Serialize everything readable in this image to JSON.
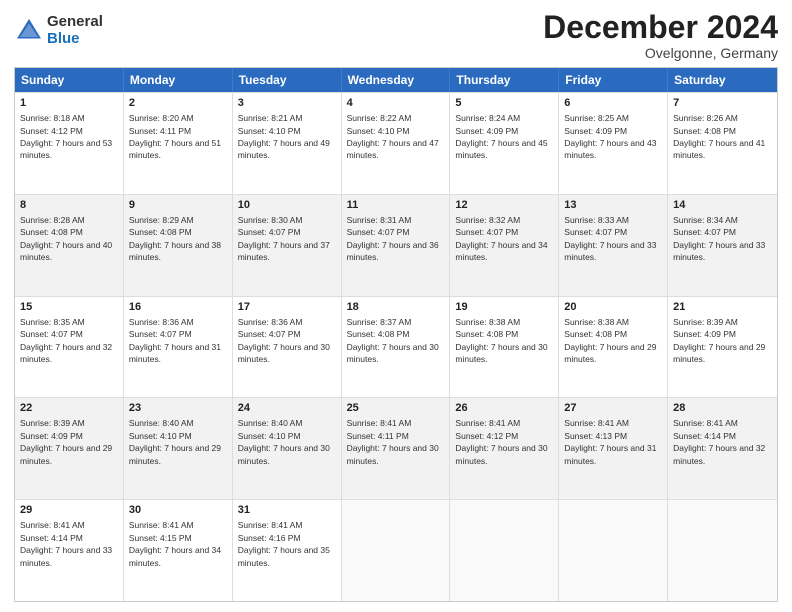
{
  "logo": {
    "general": "General",
    "blue": "Blue"
  },
  "header": {
    "title": "December 2024",
    "subtitle": "Ovelgonne, Germany"
  },
  "days": [
    "Sunday",
    "Monday",
    "Tuesday",
    "Wednesday",
    "Thursday",
    "Friday",
    "Saturday"
  ],
  "weeks": [
    [
      {
        "day": "1",
        "sunrise": "8:18 AM",
        "sunset": "4:12 PM",
        "daylight": "7 hours and 53 minutes."
      },
      {
        "day": "2",
        "sunrise": "8:20 AM",
        "sunset": "4:11 PM",
        "daylight": "7 hours and 51 minutes."
      },
      {
        "day": "3",
        "sunrise": "8:21 AM",
        "sunset": "4:10 PM",
        "daylight": "7 hours and 49 minutes."
      },
      {
        "day": "4",
        "sunrise": "8:22 AM",
        "sunset": "4:10 PM",
        "daylight": "7 hours and 47 minutes."
      },
      {
        "day": "5",
        "sunrise": "8:24 AM",
        "sunset": "4:09 PM",
        "daylight": "7 hours and 45 minutes."
      },
      {
        "day": "6",
        "sunrise": "8:25 AM",
        "sunset": "4:09 PM",
        "daylight": "7 hours and 43 minutes."
      },
      {
        "day": "7",
        "sunrise": "8:26 AM",
        "sunset": "4:08 PM",
        "daylight": "7 hours and 41 minutes."
      }
    ],
    [
      {
        "day": "8",
        "sunrise": "8:28 AM",
        "sunset": "4:08 PM",
        "daylight": "7 hours and 40 minutes."
      },
      {
        "day": "9",
        "sunrise": "8:29 AM",
        "sunset": "4:08 PM",
        "daylight": "7 hours and 38 minutes."
      },
      {
        "day": "10",
        "sunrise": "8:30 AM",
        "sunset": "4:07 PM",
        "daylight": "7 hours and 37 minutes."
      },
      {
        "day": "11",
        "sunrise": "8:31 AM",
        "sunset": "4:07 PM",
        "daylight": "7 hours and 36 minutes."
      },
      {
        "day": "12",
        "sunrise": "8:32 AM",
        "sunset": "4:07 PM",
        "daylight": "7 hours and 34 minutes."
      },
      {
        "day": "13",
        "sunrise": "8:33 AM",
        "sunset": "4:07 PM",
        "daylight": "7 hours and 33 minutes."
      },
      {
        "day": "14",
        "sunrise": "8:34 AM",
        "sunset": "4:07 PM",
        "daylight": "7 hours and 33 minutes."
      }
    ],
    [
      {
        "day": "15",
        "sunrise": "8:35 AM",
        "sunset": "4:07 PM",
        "daylight": "7 hours and 32 minutes."
      },
      {
        "day": "16",
        "sunrise": "8:36 AM",
        "sunset": "4:07 PM",
        "daylight": "7 hours and 31 minutes."
      },
      {
        "day": "17",
        "sunrise": "8:36 AM",
        "sunset": "4:07 PM",
        "daylight": "7 hours and 30 minutes."
      },
      {
        "day": "18",
        "sunrise": "8:37 AM",
        "sunset": "4:08 PM",
        "daylight": "7 hours and 30 minutes."
      },
      {
        "day": "19",
        "sunrise": "8:38 AM",
        "sunset": "4:08 PM",
        "daylight": "7 hours and 30 minutes."
      },
      {
        "day": "20",
        "sunrise": "8:38 AM",
        "sunset": "4:08 PM",
        "daylight": "7 hours and 29 minutes."
      },
      {
        "day": "21",
        "sunrise": "8:39 AM",
        "sunset": "4:09 PM",
        "daylight": "7 hours and 29 minutes."
      }
    ],
    [
      {
        "day": "22",
        "sunrise": "8:39 AM",
        "sunset": "4:09 PM",
        "daylight": "7 hours and 29 minutes."
      },
      {
        "day": "23",
        "sunrise": "8:40 AM",
        "sunset": "4:10 PM",
        "daylight": "7 hours and 29 minutes."
      },
      {
        "day": "24",
        "sunrise": "8:40 AM",
        "sunset": "4:10 PM",
        "daylight": "7 hours and 30 minutes."
      },
      {
        "day": "25",
        "sunrise": "8:41 AM",
        "sunset": "4:11 PM",
        "daylight": "7 hours and 30 minutes."
      },
      {
        "day": "26",
        "sunrise": "8:41 AM",
        "sunset": "4:12 PM",
        "daylight": "7 hours and 30 minutes."
      },
      {
        "day": "27",
        "sunrise": "8:41 AM",
        "sunset": "4:13 PM",
        "daylight": "7 hours and 31 minutes."
      },
      {
        "day": "28",
        "sunrise": "8:41 AM",
        "sunset": "4:14 PM",
        "daylight": "7 hours and 32 minutes."
      }
    ],
    [
      {
        "day": "29",
        "sunrise": "8:41 AM",
        "sunset": "4:14 PM",
        "daylight": "7 hours and 33 minutes."
      },
      {
        "day": "30",
        "sunrise": "8:41 AM",
        "sunset": "4:15 PM",
        "daylight": "7 hours and 34 minutes."
      },
      {
        "day": "31",
        "sunrise": "8:41 AM",
        "sunset": "4:16 PM",
        "daylight": "7 hours and 35 minutes."
      },
      null,
      null,
      null,
      null
    ]
  ]
}
